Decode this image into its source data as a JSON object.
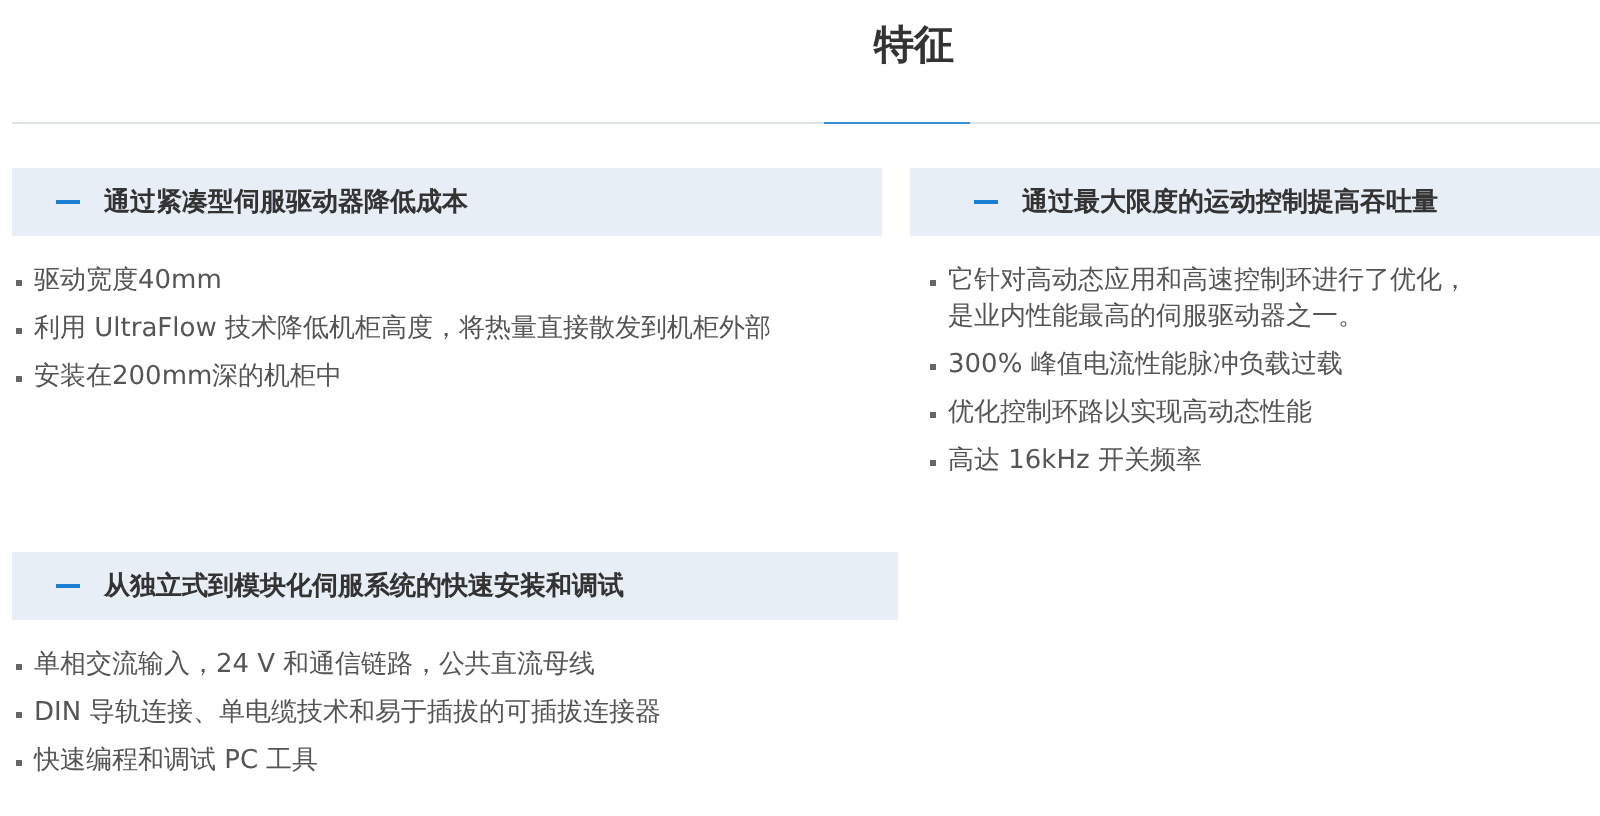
{
  "title": "特征",
  "sections": [
    {
      "heading": "通过紧凑型伺服驱动器降低成本",
      "expanded": true,
      "items": [
        "驱动宽度40mm",
        "利用 UltraFlow 技术降低机柜高度，将热量直接散发到机柜外部",
        "安装在200mm深的机柜中"
      ]
    },
    {
      "heading": "通过最大限度的运动控制提高吞吐量",
      "expanded": true,
      "items": [
        "它针对高动态应用和高速控制环进行了优化，是业内性能最高的伺服驱动器之一。",
        "300% 峰值电流性能脉冲负载过载",
        "优化控制环路以实现高动态性能",
        "高达 16kHz 开关频率"
      ]
    },
    {
      "heading": "从独立式到模块化伺服系统的快速安装和调试",
      "expanded": true,
      "items": [
        "单相交流输入，24 V 和通信链路，公共直流母线",
        "DIN 导轨连接、单电缆技术和易于插拔的可插拔连接器",
        "快速编程和调试 PC 工具"
      ]
    }
  ]
}
